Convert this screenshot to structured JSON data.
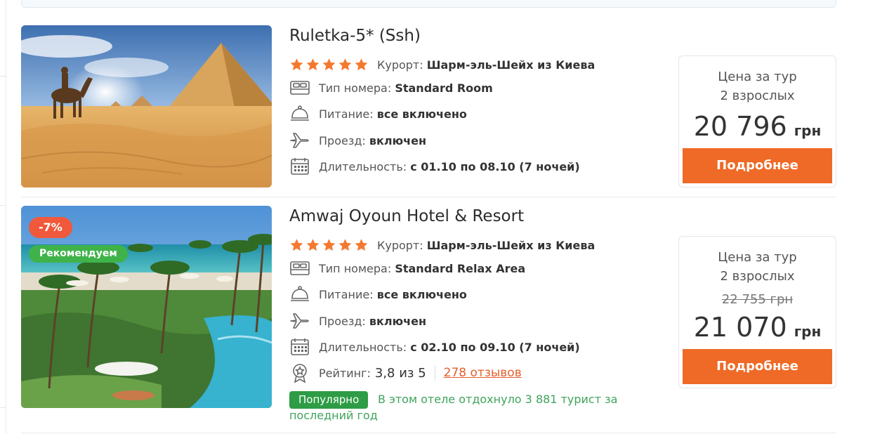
{
  "colors": {
    "accent_orange": "#ee6a26",
    "star_orange": "#f4792f",
    "discount_red": "#f0593b",
    "recommend_green": "#3fb34a",
    "popular_green": "#2e9c45",
    "link_orange": "#e35f2e"
  },
  "icons": {
    "star": "star-icon",
    "room": "bed-icon",
    "meals": "cloche-icon",
    "transport": "airplane-icon",
    "duration": "calendar-icon",
    "rating": "award-medal-icon"
  },
  "hotels": [
    {
      "name": "Ruletka-5* (Ssh)",
      "stars": 5,
      "resort_label": "Курорт:",
      "resort_value": "Шарм-эль-Шейх из Киева",
      "room_label": "Тип номера:",
      "room_value": "Standard Room",
      "meals_label": "Питание:",
      "meals_value": "все включено",
      "transport_label": "Проезд:",
      "transport_value": "включен",
      "duration_label": "Длительность:",
      "duration_value": "с 01.10 по 08.10 (7 ночей)",
      "price_label_1": "Цена за тур",
      "price_label_2": "2 взрослых",
      "price": "20 796",
      "currency": "грн",
      "button": "Подробнее"
    },
    {
      "name": "Amwaj Oyoun Hotel & Resort",
      "stars": 5,
      "discount": "-7%",
      "recommended": "Рекомендуем",
      "resort_label": "Курорт:",
      "resort_value": "Шарм-эль-Шейх из Киева",
      "room_label": "Тип номера:",
      "room_value": "Standard Relax Area",
      "meals_label": "Питание:",
      "meals_value": "все включено",
      "transport_label": "Проезд:",
      "transport_value": "включен",
      "duration_label": "Длительность:",
      "duration_value": "с 02.10 по 09.10 (7 ночей)",
      "rating_label": "Рейтинг:",
      "rating_value": "3,8 из 5",
      "reviews": "278 отзывов",
      "popular_badge": "Популярно",
      "popular_text": "В этом отеле отдохнуло 3 881 турист за последний год",
      "price_label_1": "Цена за тур",
      "price_label_2": "2 взрослых",
      "old_price": "22 755 грн",
      "price": "21 070",
      "currency": "грн",
      "button": "Подробнее"
    }
  ]
}
